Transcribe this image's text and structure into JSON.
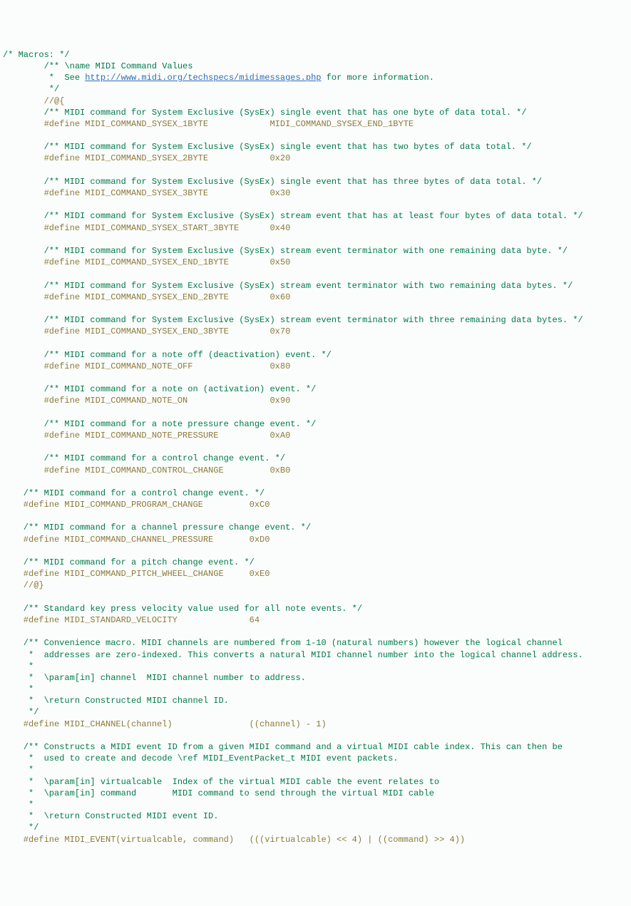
{
  "l1": "/* Macros: */",
  "l2": "        /** \\name MIDI Command Values",
  "l3a": "         *  See ",
  "l3b": "http://www.midi.org/techspecs/midimessages.php",
  "l3c": " for more information.",
  "l4": "         */",
  "l5": "        //@{",
  "l6": "        /** MIDI command for System Exclusive (SysEx) single event that has one byte of data total. */",
  "l7a": "        #define MIDI_COMMAND_SYSEX_1BYTE            ",
  "l7b": "MIDI_COMMAND_SYSEX_END_1BYTE",
  "l8": "",
  "l9": "        /** MIDI command for System Exclusive (SysEx) single event that has two bytes of data total. */",
  "l10a": "        #define MIDI_COMMAND_SYSEX_2BYTE            ",
  "l10b": "0x20",
  "l11": "",
  "l12": "        /** MIDI command for System Exclusive (SysEx) single event that has three bytes of data total. */",
  "l13a": "        #define MIDI_COMMAND_SYSEX_3BYTE            ",
  "l13b": "0x30",
  "l14": "",
  "l15": "        /** MIDI command for System Exclusive (SysEx) stream event that has at least four bytes of data total. */",
  "l16a": "        #define MIDI_COMMAND_SYSEX_START_3BYTE      ",
  "l16b": "0x40",
  "l17": "",
  "l18": "        /** MIDI command for System Exclusive (SysEx) stream event terminator with one remaining data byte. */",
  "l19a": "        #define MIDI_COMMAND_SYSEX_END_1BYTE        ",
  "l19b": "0x50",
  "l20": "",
  "l21": "        /** MIDI command for System Exclusive (SysEx) stream event terminator with two remaining data bytes. */",
  "l22a": "        #define MIDI_COMMAND_SYSEX_END_2BYTE        ",
  "l22b": "0x60",
  "l23": "",
  "l24": "        /** MIDI command for System Exclusive (SysEx) stream event terminator with three remaining data bytes. */",
  "l25a": "        #define MIDI_COMMAND_SYSEX_END_3BYTE        ",
  "l25b": "0x70",
  "l26": "",
  "l27": "        /** MIDI command for a note off (deactivation) event. */",
  "l28a": "        #define MIDI_COMMAND_NOTE_OFF               ",
  "l28b": "0x80",
  "l29": "",
  "l30": "        /** MIDI command for a note on (activation) event. */",
  "l31a": "        #define MIDI_COMMAND_NOTE_ON                ",
  "l31b": "0x90",
  "l32": "",
  "l33": "        /** MIDI command for a note pressure change event. */",
  "l34a": "        #define MIDI_COMMAND_NOTE_PRESSURE          ",
  "l34b": "0xA0",
  "l35": "",
  "l36": "        /** MIDI command for a control change event. */",
  "l37a": "        #define MIDI_COMMAND_CONTROL_CHANGE         ",
  "l37b": "0xB0",
  "l38": "",
  "l39": "    /** MIDI command for a control change event. */",
  "l40a": "    #define MIDI_COMMAND_PROGRAM_CHANGE         ",
  "l40b": "0xC0",
  "l41": "",
  "l42": "    /** MIDI command for a channel pressure change event. */",
  "l43a": "    #define MIDI_COMMAND_CHANNEL_PRESSURE       ",
  "l43b": "0xD0",
  "l44": "",
  "l45": "    /** MIDI command for a pitch change event. */",
  "l46a": "    #define MIDI_COMMAND_PITCH_WHEEL_CHANGE     ",
  "l46b": "0xE0",
  "l47": "    //@}",
  "l48": "",
  "l49": "    /** Standard key press velocity value used for all note events. */",
  "l50a": "    #define MIDI_STANDARD_VELOCITY              ",
  "l50b": "64",
  "l51": "",
  "l52": "    /** Convenience macro. MIDI channels are numbered from 1-10 (natural numbers) however the logical channel",
  "l53": "     *  addresses are zero-indexed. This converts a natural MIDI channel number into the logical channel address.",
  "l54": "     *",
  "l55": "     *  \\param[in] channel  MIDI channel number to address.",
  "l56": "     *",
  "l57": "     *  \\return Constructed MIDI channel ID.",
  "l58": "     */",
  "l59a": "    #define MIDI_CHANNEL(channel)               ",
  "l59b": "((channel) - 1)",
  "l60": "",
  "l61": "    /** Constructs a MIDI event ID from a given MIDI command and a virtual MIDI cable index. This can then be",
  "l62": "     *  used to create and decode \\ref MIDI_EventPacket_t MIDI event packets.",
  "l63": "     *",
  "l64": "     *  \\param[in] virtualcable  Index of the virtual MIDI cable the event relates to",
  "l65": "     *  \\param[in] command       MIDI command to send through the virtual MIDI cable",
  "l66": "     *",
  "l67": "     *  \\return Constructed MIDI event ID.",
  "l68": "     */",
  "l69a": "    #define MIDI_EVENT(virtualcable, command)   ",
  "l69b": "(((virtualcable) << 4) | ((command) >> 4))"
}
